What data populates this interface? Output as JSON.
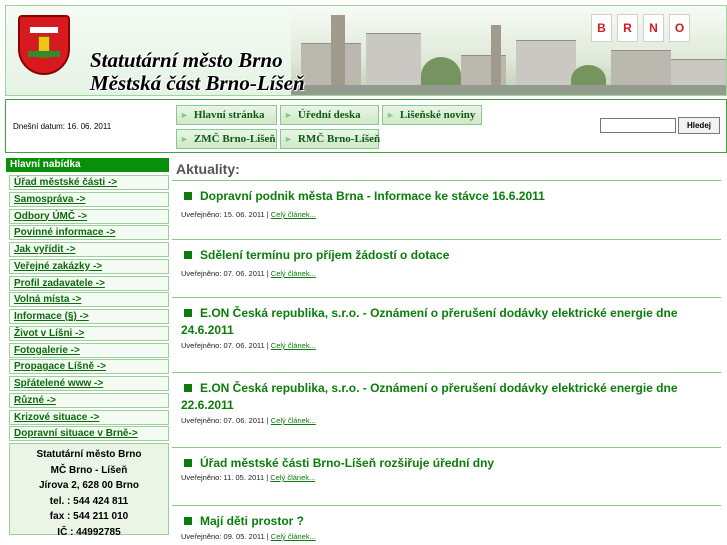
{
  "header": {
    "title_line1": "Statutární město Brno",
    "title_line2": "Městská část Brno-Líšeň",
    "logo_letters": [
      "B",
      "R",
      "N",
      "O"
    ],
    "brand_color": "#d71920"
  },
  "navbar": {
    "date_text": "Dnešní datum: 16. 06. 2011",
    "buttons": [
      {
        "label": "Hlavní stránka"
      },
      {
        "label": "Úřední deska"
      },
      {
        "label": "Lišeňské noviny"
      },
      {
        "label": "ZMČ Brno-Líšeň"
      },
      {
        "label": "RMČ Brno-Líšeň"
      }
    ],
    "search_value": "",
    "search_button": "Hledej"
  },
  "sidebar": {
    "title": "Hlavní nabídka",
    "items": [
      {
        "label": "Úřad městské části ->"
      },
      {
        "label": "Samospráva ->"
      },
      {
        "label": "Odbory ÚMČ ->"
      },
      {
        "label": "Povinné informace ->"
      },
      {
        "label": "Jak vyřídit ->"
      },
      {
        "label": "Veřejné zakázky ->"
      },
      {
        "label": "Profil zadavatele ->"
      },
      {
        "label": "Volná místa ->"
      },
      {
        "label": "Informace (§) ->"
      },
      {
        "label": "Život v Líšni ->"
      },
      {
        "label": "Fotogalerie ->"
      },
      {
        "label": "Propagace Líšně ->"
      },
      {
        "label": "Spřátelené www ->"
      },
      {
        "label": "Různé ->"
      },
      {
        "label": "Krizové situace ->"
      },
      {
        "label": "Dopravní situace v Brně->"
      }
    ],
    "address": {
      "line1": "Statutární město Brno",
      "line2": "MČ Brno - Líšeň",
      "line3": "Jírova 2, 628 00 Brno",
      "line4": "tel. : 544 424 811",
      "line5": "fax : 544 211 010",
      "line6": "IČ : 44992785"
    }
  },
  "main": {
    "heading": "Aktuality:",
    "articles": [
      {
        "title": "Dopravní podnik města Brna - Informace ke stávce 16.6.2011",
        "published": "Uveřejněno: 15. 06. 2011",
        "link": "Celý článek..."
      },
      {
        "title": "Sdělení termínu pro příjem žádostí o dotace",
        "published": "Uveřejněno: 07. 06. 2011",
        "link": "Celý článek..."
      },
      {
        "title": "E.ON Česká republika, s.r.o. - Oznámení o přerušení dodávky elektrické energie dne 24.6.2011",
        "published": "Uveřejněno: 07. 06. 2011",
        "link": "Celý článek..."
      },
      {
        "title": "E.ON Česká republika, s.r.o. - Oznámení o přerušení dodávky elektrické energie dne 22.6.2011",
        "published": "Uveřejněno: 07. 06. 2011",
        "link": "Celý článek..."
      },
      {
        "title": "Úřad městské části Brno-Líšeň rozšiřuje úřední dny",
        "published": "Uveřejněno: 11. 05. 2011",
        "link": "Celý článek..."
      },
      {
        "title": "Mají děti prostor ?",
        "published": "Uveřejněno: 09. 05. 2011",
        "link": "Celý článek..."
      }
    ]
  },
  "colors": {
    "accent_green": "#0a8f0a",
    "link_green": "#0a7d0a",
    "border_green": "#9bd09b"
  }
}
